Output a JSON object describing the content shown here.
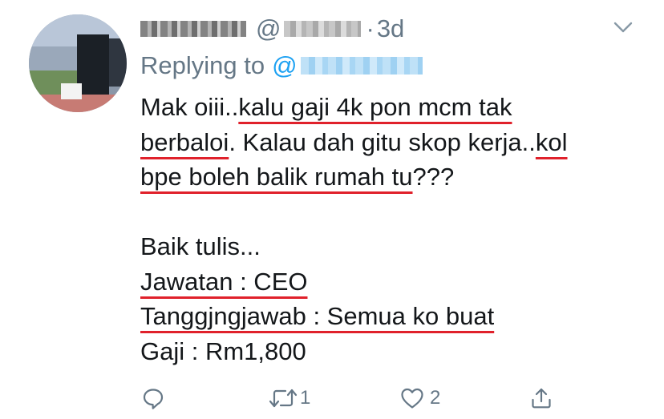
{
  "tweet": {
    "time_sep": "·",
    "time": "3d",
    "handle_prefix": "@",
    "replying_label": "Replying to",
    "replying_at": "@",
    "lines": [
      [
        {
          "text": "Mak oiii..",
          "u": false
        },
        {
          "text": "kalu gaji 4k pon mcm tak",
          "u": true
        }
      ],
      [
        {
          "text": "berbaloi",
          "u": true
        },
        {
          "text": ". Kalau dah gitu skop kerja..",
          "u": false
        },
        {
          "text": "kol",
          "u": true
        }
      ],
      [
        {
          "text": "bpe boleh balik rumah tu",
          "u": true
        },
        {
          "text": "???",
          "u": false
        }
      ],
      [],
      [
        {
          "text": "Baik tulis...",
          "u": false
        }
      ],
      [
        {
          "text": "Jawatan : CEO",
          "u": true
        }
      ],
      [
        {
          "text": "Tanggjngjawab : Semua ko buat",
          "u": true
        }
      ],
      [
        {
          "text": "Gaji : Rm1,800",
          "u": false
        }
      ]
    ],
    "actions": {
      "reply_count": "",
      "retweet_count": "1",
      "like_count": "2"
    }
  },
  "icons": [
    "reply-icon",
    "retweet-icon",
    "like-icon",
    "share-icon",
    "chevron-down-icon"
  ],
  "colors": {
    "text": "#14171a",
    "muted": "#657786",
    "link": "#1da1f2",
    "underline": "#e0212b"
  }
}
